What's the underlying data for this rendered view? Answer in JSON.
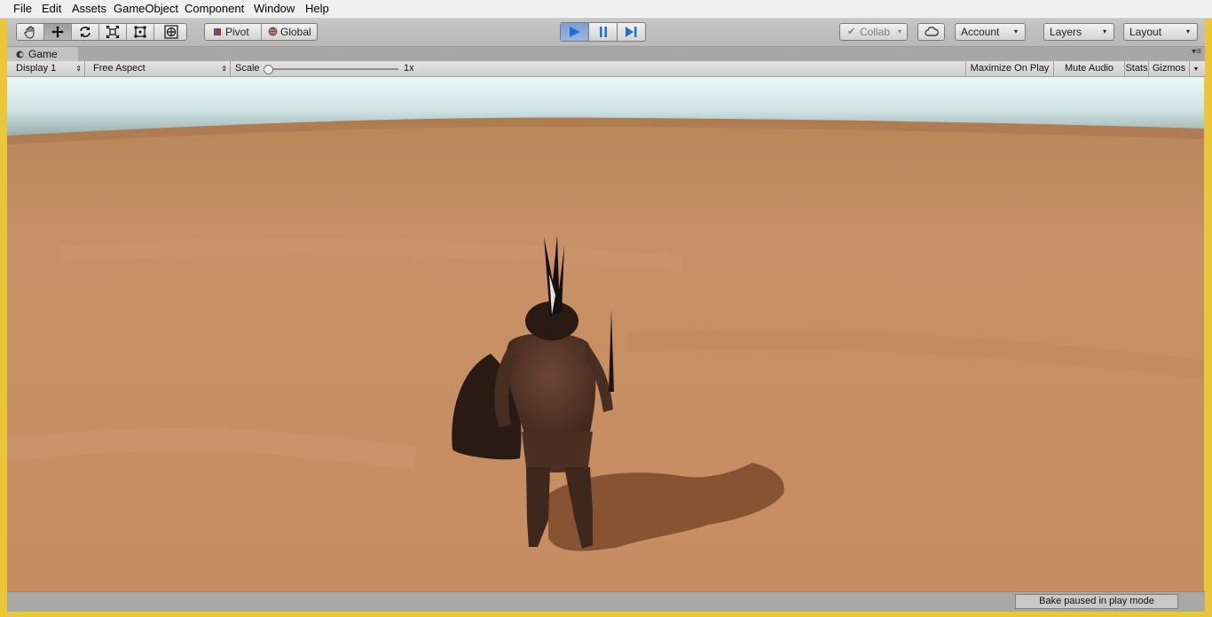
{
  "menu": [
    "File",
    "Edit",
    "Assets",
    "GameObject",
    "Component",
    "Window",
    "Help"
  ],
  "toolbar": {
    "tools": [
      "hand-icon",
      "move-icon",
      "rotate-icon",
      "scale-icon",
      "rect-transform-icon",
      "transform-icon"
    ],
    "active_tool": "move-icon",
    "pivot_label": "Pivot",
    "global_label": "Global",
    "playback": [
      "play-icon",
      "pause-icon",
      "step-icon"
    ],
    "collab_label": "Collab",
    "account_label": "Account",
    "layers_label": "Layers",
    "layout_label": "Layout"
  },
  "game_tab": {
    "title": "Game",
    "display_label": "Display 1",
    "aspect_label": "Free Aspect",
    "scale_label": "Scale",
    "scale_value": "1x",
    "maximize_label": "Maximize On Play",
    "mute_label": "Mute Audio",
    "stats_label": "Stats",
    "gizmos_label": "Gizmos"
  },
  "status": {
    "bake_text": "Bake paused in play mode"
  },
  "colors": {
    "play_active": "#2f7fe0",
    "terrain": "#c2895d",
    "sky": "#eaf6f7"
  }
}
